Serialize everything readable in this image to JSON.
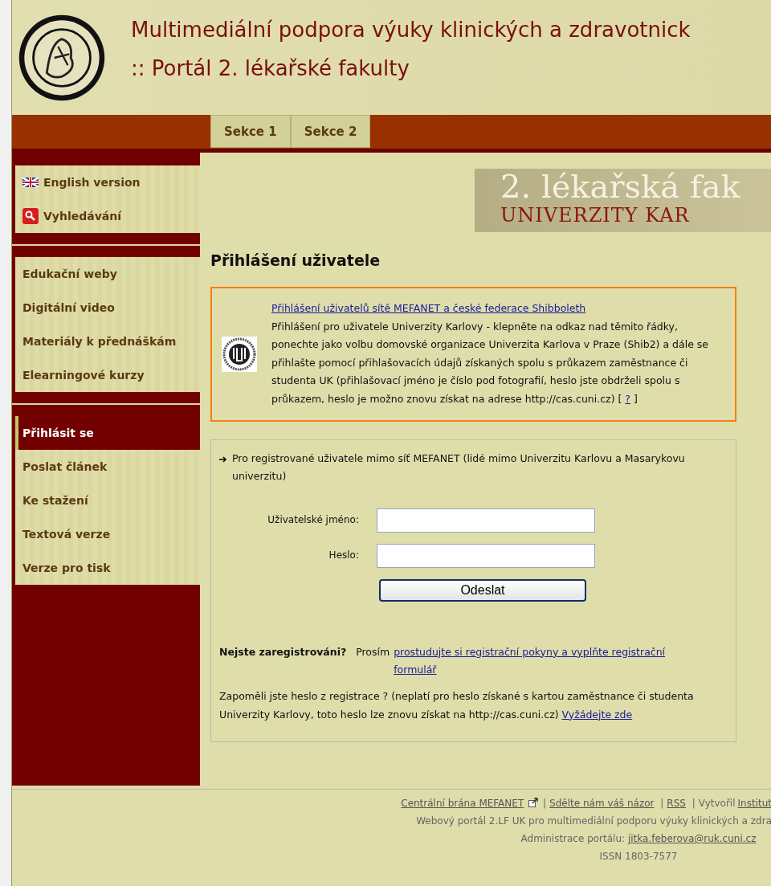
{
  "header": {
    "title": "Multimediální podpora výuky klinických a zdravotnick",
    "subtitle": ":: Portál 2. lékařské fakulty"
  },
  "tabs": [
    {
      "label": "Sekce 1",
      "selected": false
    },
    {
      "label": "Sekce 2",
      "selected": false
    }
  ],
  "sidebar": {
    "groups": [
      {
        "items": [
          {
            "label": "English version",
            "kind": "flag",
            "selected": false
          },
          {
            "label": "Vyhledávání",
            "kind": "search",
            "selected": false
          }
        ]
      },
      {
        "items": [
          {
            "label": "Edukační weby",
            "kind": "plain",
            "selected": false
          },
          {
            "label": "Digitální video",
            "kind": "plain",
            "selected": false
          },
          {
            "label": "Materiály k přednáškám",
            "kind": "plain",
            "selected": false
          },
          {
            "label": "Elearningové kurzy",
            "kind": "plain",
            "selected": false
          }
        ]
      },
      {
        "items": [
          {
            "label": "Přihlásit se",
            "kind": "plain",
            "selected": true
          },
          {
            "label": "Poslat článek",
            "kind": "plain",
            "selected": false
          },
          {
            "label": "Ke stažení",
            "kind": "plain",
            "selected": false
          },
          {
            "label": "Textová verze",
            "kind": "plain",
            "selected": false
          },
          {
            "label": "Verze pro tisk",
            "kind": "plain",
            "selected": false
          }
        ]
      }
    ]
  },
  "banner": {
    "line_1": "2. lékařská fak",
    "line_2": "UNIVERZITY KAR"
  },
  "page_title": "Přihlášení uživatele",
  "federated_login": {
    "link": "Přihlášení uživatelů sítě MEFANET a české federace Shibboleth",
    "text": "Přihlášení pro uživatele Univerzity Karlovy - klepněte na odkaz nad těmito řádky, ponechte jako volbu domovské organizace Univerzita Karlova v Praze (Shib2) a dále se přihlašte pomocí přihlašovacích údajů získaných spolu s průkazem zaměstnance či studenta UK (přihlašovací jméno je číslo pod fotografií, heslo jste obdrželi spolu s průkazem, heslo je možno znovu získat na adrese http://cas.cuni.cz) [",
    "help_link": "?",
    "text_end": "]"
  },
  "local_login": {
    "intro": "Pro registrované uživatele mimo síť MEFANET (lidé mimo Univerzitu Karlovu a Masarykovu univerzitu)",
    "fields": [
      {
        "label": "Uživatelské jméno:"
      },
      {
        "label": "Heslo:"
      }
    ],
    "submit": "Odeslat",
    "register_lead": "Nejste zaregistrováni?",
    "register_text": "Prosím",
    "register_link": "prostudujte si registrační pokyny a vyplňte registrační formulář",
    "forgot_text": "Zapoměli jste heslo z registrace ? (neplatí pro heslo získané s kartou zaměstnance či studenta Univerzity Karlovy, toto heslo lze znovu získat na http://cas.cuni.cz)",
    "forgot_link": "Vyžádejte zde"
  },
  "footer": {
    "links": [
      {
        "kind": "link",
        "text": "Centrální brána MEFANET",
        "external": true
      },
      {
        "kind": "separator",
        "text": "|"
      },
      {
        "kind": "link",
        "text": "Sdělte nám váš názor",
        "external": false
      },
      {
        "kind": "separator",
        "text": "|"
      },
      {
        "kind": "link",
        "text": "RSS",
        "external": false
      },
      {
        "kind": "separator",
        "text": "|"
      },
      {
        "kind": "text",
        "text": "Vytvořil"
      },
      {
        "kind": "link",
        "text": "Institut",
        "external": false
      }
    ],
    "description": "Webový portál 2.LF UK pro multimediální podporu výuky klinických a zdra",
    "admin_label": "Administrace portálu:",
    "admin_email": "jitka.feberova@ruk.cuni.cz",
    "issn": "ISSN 1803-7577"
  }
}
